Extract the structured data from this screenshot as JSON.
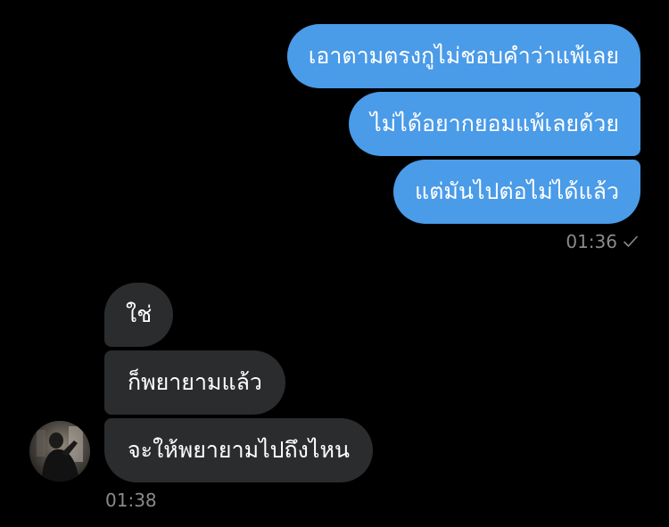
{
  "sent_messages": [
    {
      "text": "เอาตามตรงกูไม่ชอบคำว่าแพ้เลย"
    },
    {
      "text": "ไม่ได้อยากยอมแพ้เลยด้วย"
    },
    {
      "text": "แต่มันไปต่อไม่ได้แล้ว"
    }
  ],
  "sent_time": "01:36",
  "received_messages": [
    {
      "text": "ใช่"
    },
    {
      "text": "ก็พยายามแล้ว"
    },
    {
      "text": "จะให้พยายามไปถึงไหน"
    }
  ],
  "received_time": "01:38",
  "colors": {
    "background": "#000000",
    "sent_bubble": "#4a9be8",
    "received_bubble": "#2b2c2e",
    "timestamp": "#8a8a8e"
  },
  "icons": {
    "delivered": "check-icon",
    "avatar": "avatar-photo"
  }
}
